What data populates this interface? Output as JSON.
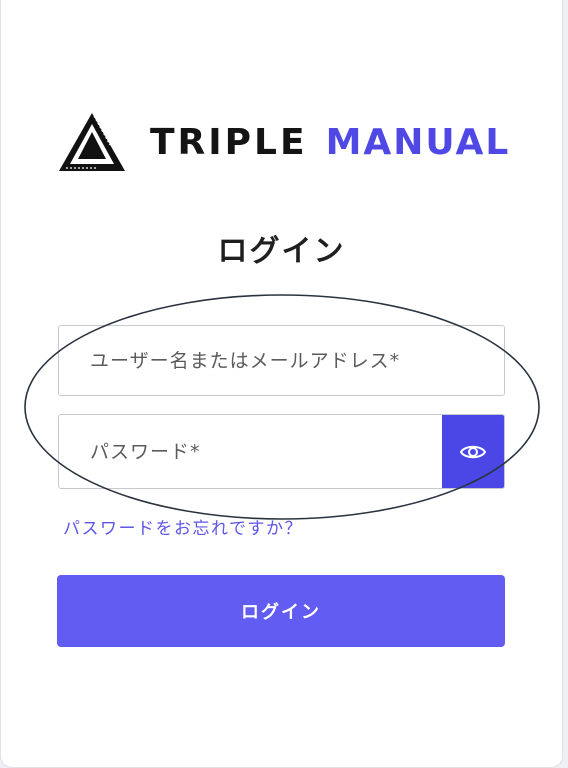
{
  "logo": {
    "icon": "triangle-logo-icon",
    "brand_part1": "TRIPLE",
    "brand_part2": "MANUAL",
    "brand_part2_color": "#5048e5"
  },
  "form": {
    "title": "ログイン",
    "username_placeholder": "ユーザー名またはメールアドレス*",
    "password_placeholder": "パスワード*",
    "show_password_icon": "eye-icon",
    "forgot_link": "パスワードをお忘れですか？",
    "submit_label": "ログイン"
  },
  "colors": {
    "accent": "#5048e5",
    "button": "#625cf3",
    "eye_button": "#4b46e6"
  }
}
